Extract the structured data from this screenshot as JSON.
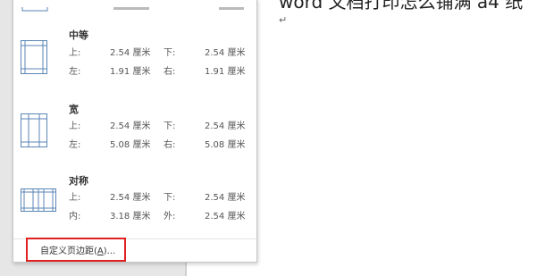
{
  "document": {
    "title": "word 文档打印怎么铺满 a4 纸",
    "paragraph_mark": "↵"
  },
  "presets": [
    {
      "name": "中等",
      "row1": {
        "l1": "上:",
        "v1": "2.54 厘米",
        "l2": "下:",
        "v2": "2.54 厘米"
      },
      "row2": {
        "l1": "左:",
        "v1": "1.91 厘米",
        "l2": "右:",
        "v2": "1.91 厘米"
      }
    },
    {
      "name": "宽",
      "row1": {
        "l1": "上:",
        "v1": "2.54 厘米",
        "l2": "下:",
        "v2": "2.54 厘米"
      },
      "row2": {
        "l1": "左:",
        "v1": "5.08 厘米",
        "l2": "右:",
        "v2": "5.08 厘米"
      }
    },
    {
      "name": "对称",
      "row1": {
        "l1": "上:",
        "v1": "2.54 厘米",
        "l2": "下:",
        "v2": "2.54 厘米"
      },
      "row2": {
        "l1": "内:",
        "v1": "3.18 厘米",
        "l2": "外:",
        "v2": "2.54 厘米"
      }
    }
  ],
  "custom_margins": {
    "label_prefix": "自定义页边距(",
    "accelerator": "A",
    "label_suffix": ")..."
  },
  "colors": {
    "highlight_border": "#e02020",
    "icon_blue": "#5b86b5"
  }
}
